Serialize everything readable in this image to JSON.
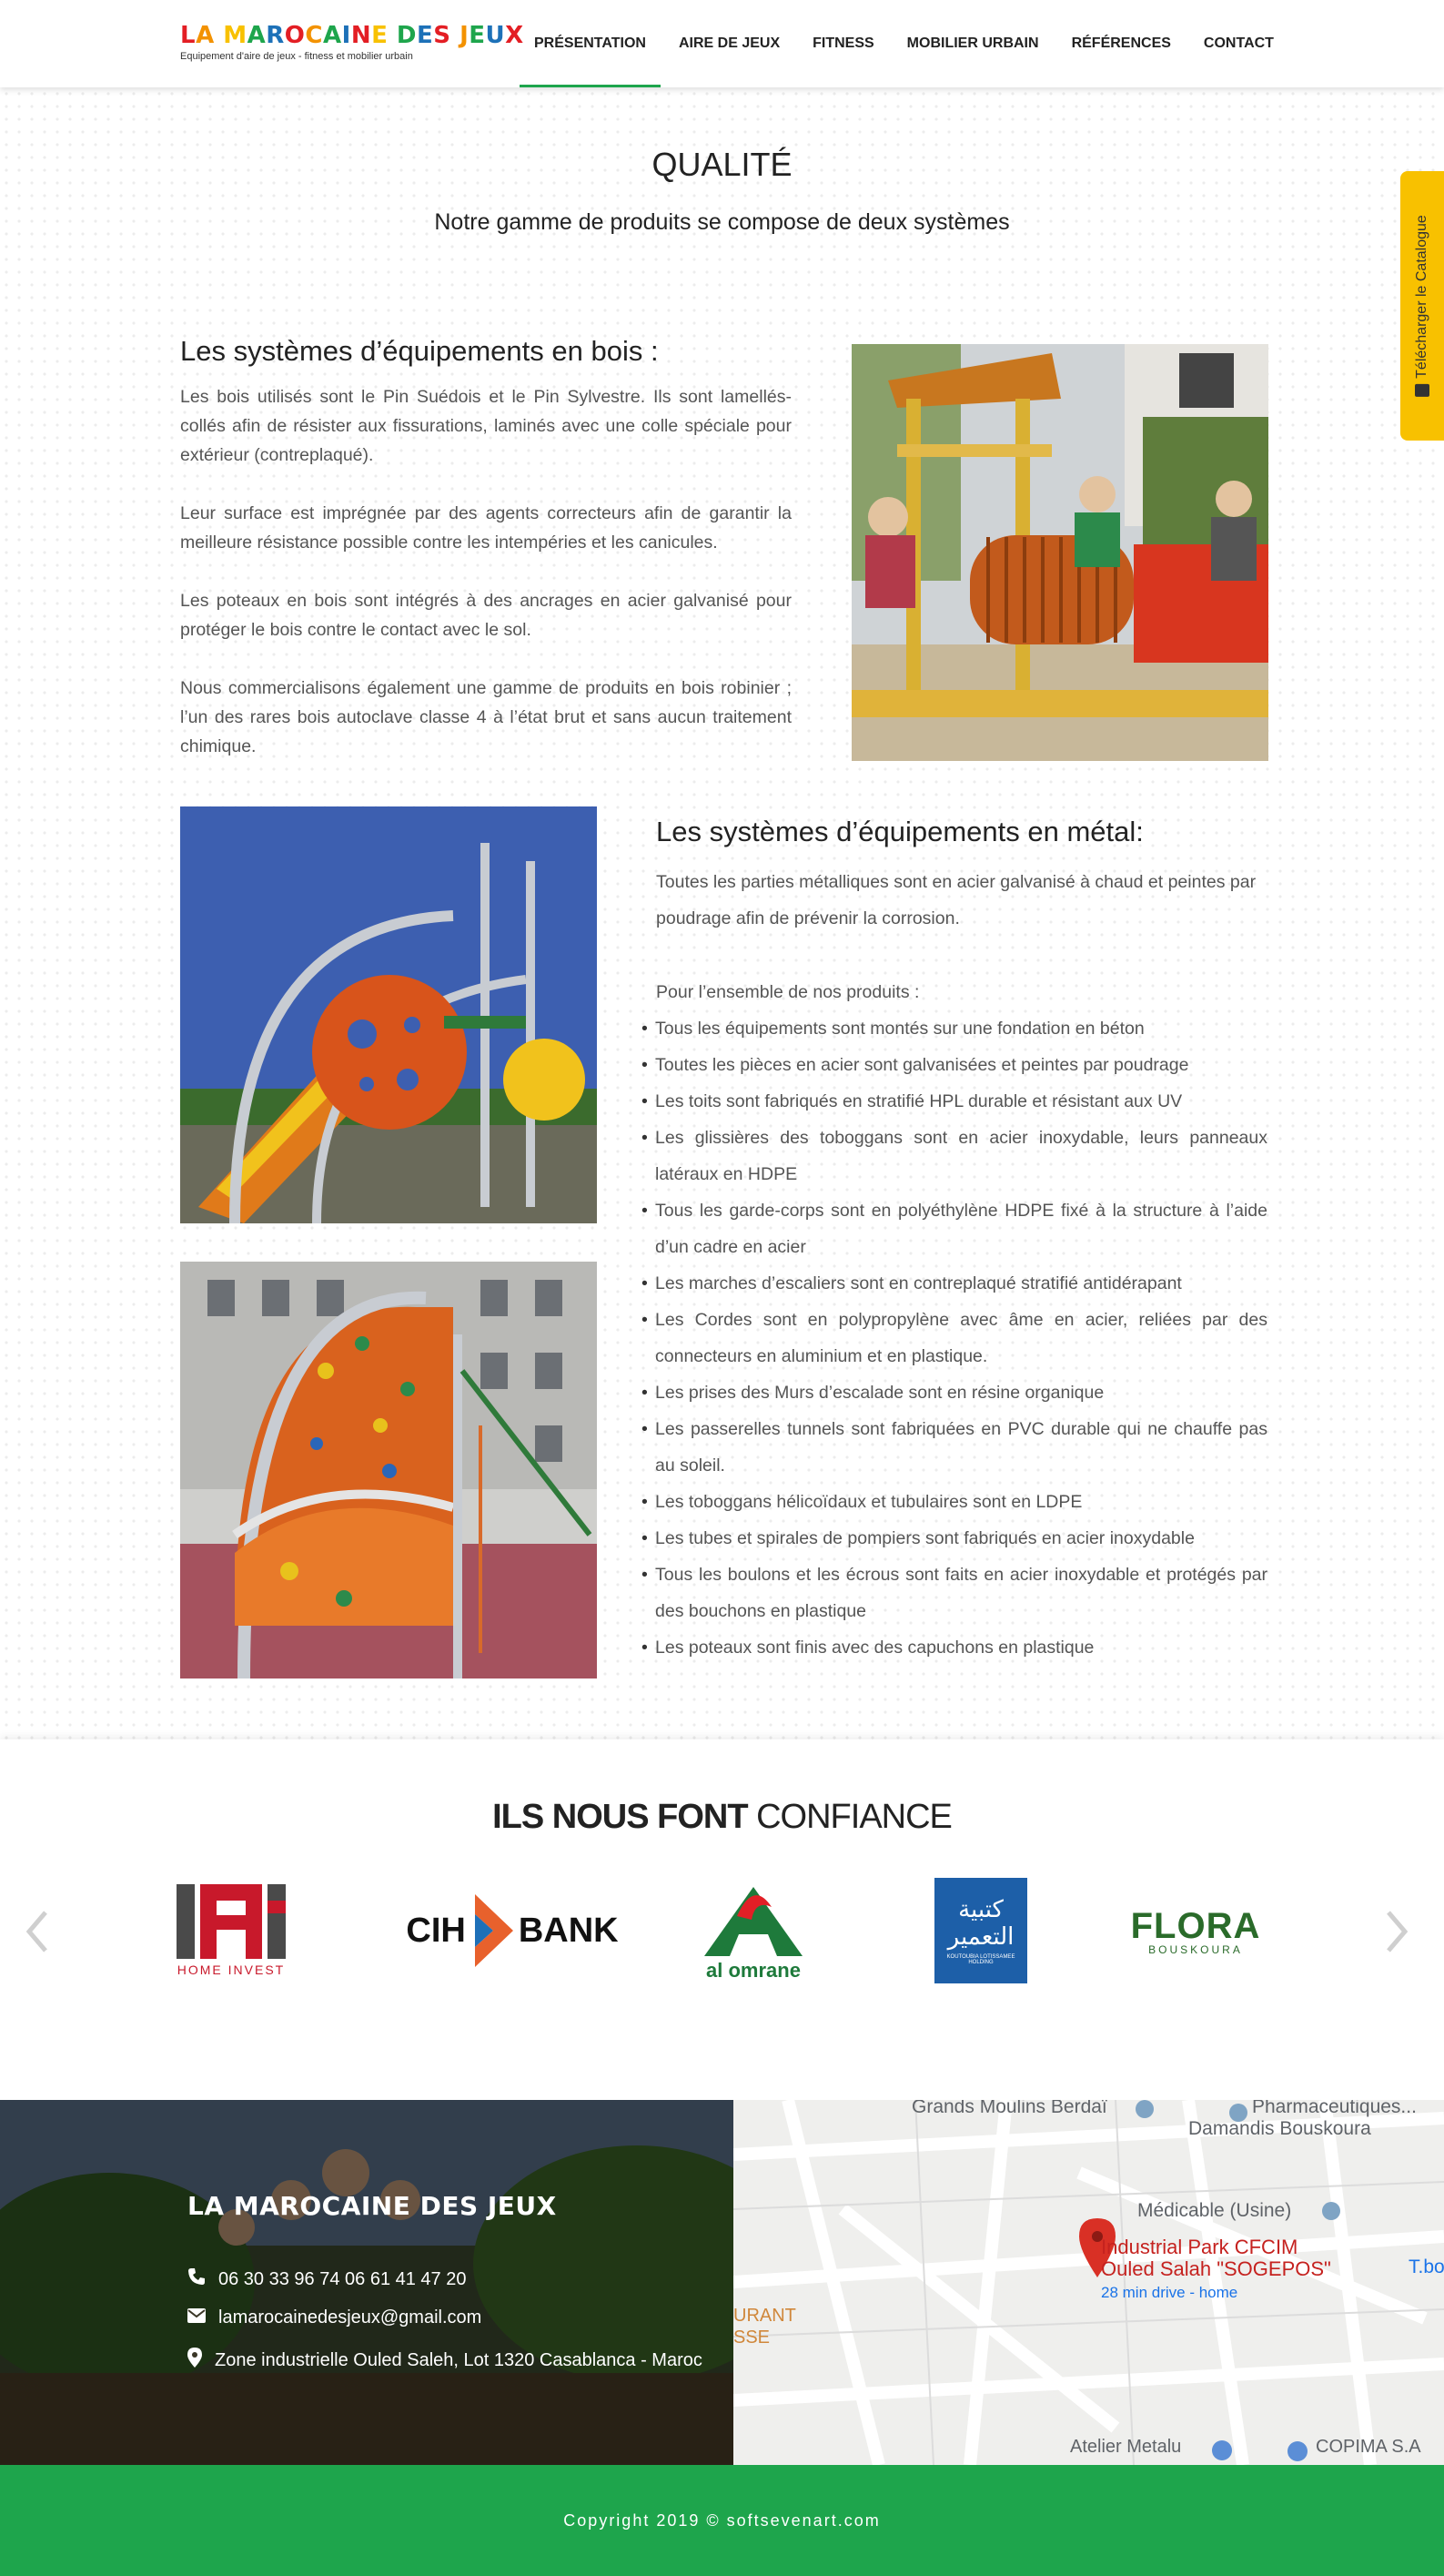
{
  "brand": {
    "name": "LA MAROCAINE DES JEUX",
    "tagline": "Equipement d'aire de jeux - fitness et mobilier urbain",
    "letter_colors": [
      "#e31e24",
      "#f39200",
      "#f8c100",
      "#1ea54c",
      "#1d71b8",
      "#e31e24",
      "#f39200",
      "#1ea54c",
      "#1d71b8",
      "#e31e24",
      "#f8c100",
      "#1ea54c",
      "#1d71b8",
      "#e31e24",
      "#f39200",
      "#1ea54c",
      "#1d71b8",
      "#e31e24",
      "#f8c100",
      "#1ea54c",
      "#1d71b8"
    ]
  },
  "nav": {
    "items": [
      "PRÉSENTATION",
      "AIRE DE JEUX",
      "FITNESS",
      "MOBILIER URBAIN",
      "RÉFÉRENCES",
      "CONTACT"
    ],
    "active_index": 0,
    "active_color": "#1ea54c"
  },
  "catalog_tab": {
    "label": "Télécharger le Catalogue",
    "icon": "pdf-icon",
    "color": "#f8c100"
  },
  "quality": {
    "title": "QUALITÉ",
    "subtitle": "Notre gamme de produits se compose de deux systèmes",
    "wood": {
      "title": "Les systèmes d’équipements en bois :",
      "paragraphs": [
        "Les bois utilisés sont le Pin Suédois et le Pin Sylvestre. Ils sont lamellés-collés afin de résister aux fissurations, laminés avec une colle spéciale pour extérieur (contreplaqué).",
        "Leur surface est imprégnée par des agents  correcteurs afin de garantir la meilleure résistance possible contre les intempéries et les canicules.",
        "Les poteaux en bois sont intégrés à des ancrages en acier galvanisé pour protéger le bois contre le contact avec le sol.",
        "Nous commercialisons également une gamme de produits en bois robinier ; l’un des rares bois autoclave classe 4 à l’état brut et sans aucun traitement chimique."
      ]
    },
    "metal": {
      "title": "Les systèmes d’équipements en métal:",
      "intro": "Toutes les parties métalliques sont en acier galvanisé à chaud et peintes par poudrage afin de prévenir la corrosion.",
      "lead": "Pour l’ensemble de nos produits :",
      "items": [
        "Tous les équipements sont montés sur une fondation en béton",
        "Toutes les pièces en acier sont galvanisées et peintes par poudrage",
        "Les toits sont fabriqués en stratifié HPL durable et résistant aux UV",
        "Les glissières des toboggans sont en acier inoxydable, leurs panneaux latéraux en HDPE",
        "Tous les garde-corps sont en polyéthylène HDPE fixé à la structure à l’aide d’un cadre en acier",
        "Les marches d’escaliers sont en contreplaqué stratifié antidérapant",
        "Les Cordes sont en polypropylène avec âme en acier, reliées par des connecteurs en aluminium et en plastique.",
        "Les prises des Murs d’escalade sont en résine organique",
        "Les passerelles tunnels sont fabriquées en PVC durable qui ne chauffe pas au soleil.",
        "Les toboggans hélicoïdaux et tubulaires sont en LDPE",
        "Les tubes et spirales de pompiers sont fabriqués en acier inoxydable",
        "Tous les boulons et les écrous sont faits en acier inoxydable et protégés par des bouchons en plastique",
        "Les poteaux sont finis avec des capuchons en plastique"
      ]
    }
  },
  "partners": {
    "title_bold": "ILS NOUS FONT",
    "title_light": "CONFIANCE",
    "logos": [
      {
        "name": "HOME INVEST",
        "mark": "Hi"
      },
      {
        "name": "CIH BANK",
        "part1": "CIH",
        "part2": "BANK"
      },
      {
        "name": "al omrane"
      },
      {
        "name": "كتبية التعمير",
        "sub": "KOUTOUBIA LOTISSAMEE HOLDING"
      },
      {
        "name": "FLORA",
        "sub": "BOUSKOURA"
      }
    ],
    "prev_icon": "chevron-left-icon",
    "next_icon": "chevron-right-icon"
  },
  "footer": {
    "brand": "LA MAROCAINE DES JEUX",
    "phone": "06 30 33 96 74  06 61 41 47 20",
    "email": "lamarocainedesjeux@gmail.com",
    "address": "Zone industrielle Ouled Saleh, Lot 1320  Casablanca - Maroc",
    "map": {
      "pin_title_1": "Industrial Park CFCIM",
      "pin_title_2": "Ouled Salah \"SOGEPOS\"",
      "pin_sub": "28 min drive - home",
      "labels": [
        "Grands Moulins Berdaï",
        "Pharmaceutiques...",
        "Damandis Bouskoura",
        "Médicable (Usine)",
        "T.bo",
        "URANT",
        "SSE",
        "Atelier Metalu",
        "COPIMA S.A"
      ]
    },
    "copyright": "Copyright 2019 © softsevenart.com",
    "green": "#1ea54c"
  }
}
